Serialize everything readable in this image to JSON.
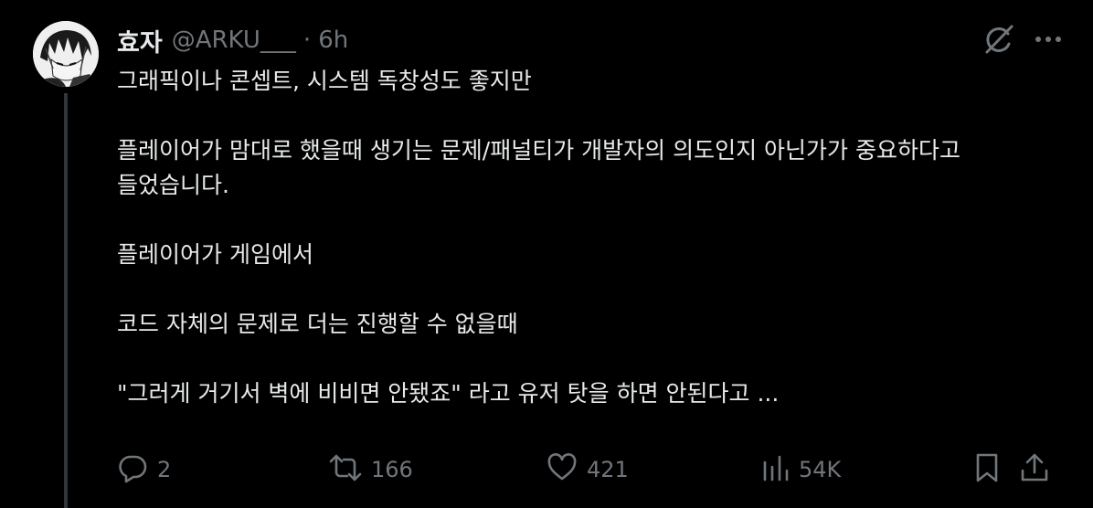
{
  "tweet": {
    "author": {
      "display_name": "효자",
      "handle": "@ARKU___",
      "avatar": "avatar-image"
    },
    "separator": "·",
    "time": "6h",
    "paragraphs": [
      "그래픽이나 콘셉트, 시스템 독창성도 좋지만",
      "플레이어가 맘대로 했을때 생기는 문제/패널티가 개발자의 의도인지 아닌가가 중요하다고\n들었습니다.",
      "플레이어가 게임에서",
      "코드 자체의 문제로 더는 진행할 수 없을때",
      "\"그러게 거기서 벽에 비비면 안됐죠\" 라고 유저 탓을 하면 안된다고 ..."
    ],
    "top_icons": [
      "grok-icon",
      "more-icon"
    ],
    "actions": {
      "replies": {
        "icon": "reply-icon",
        "count": "2"
      },
      "reposts": {
        "icon": "repost-icon",
        "count": "166"
      },
      "likes": {
        "icon": "heart-icon",
        "count": "421"
      },
      "views": {
        "icon": "views-icon",
        "count": "54K"
      },
      "bookmark": {
        "icon": "bookmark-icon"
      },
      "share": {
        "icon": "share-icon"
      }
    }
  },
  "colors": {
    "background": "#000000",
    "text_primary": "#e7e9ea",
    "text_secondary": "#71767b",
    "thread_line": "#333639"
  }
}
